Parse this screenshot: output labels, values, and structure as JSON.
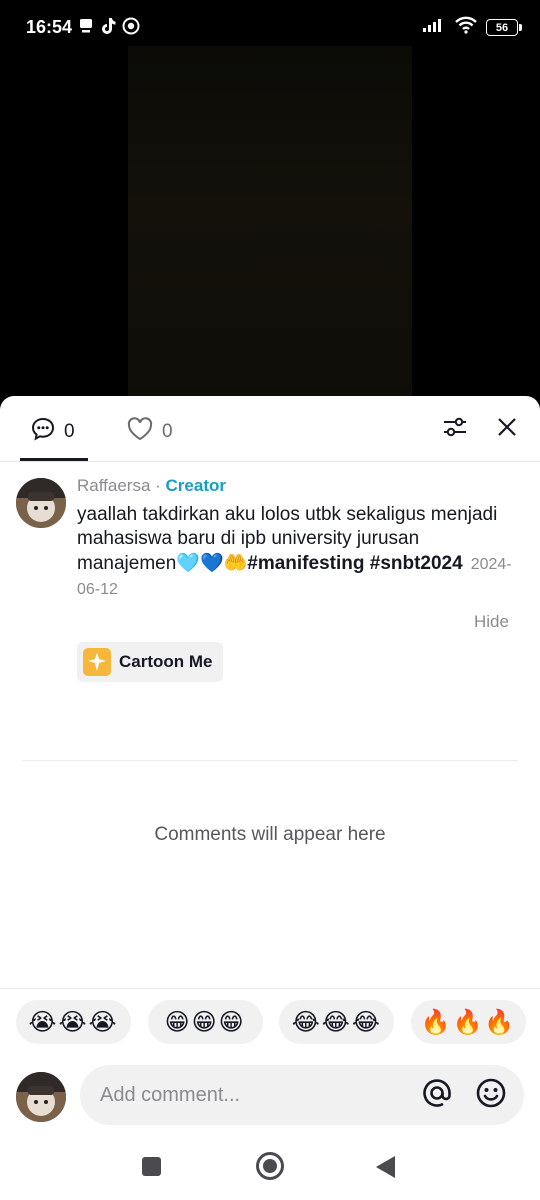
{
  "status_bar": {
    "time": "16:54",
    "battery": "56",
    "left_icons": [
      "notification-icon",
      "tiktok-icon",
      "cast-icon"
    ],
    "right_icons": [
      "signal-icon",
      "wifi-icon",
      "battery-icon"
    ]
  },
  "tabs": {
    "comments_count": "0",
    "likes_count": "0"
  },
  "caption": {
    "username": "Raffaersa",
    "separator": " · ",
    "role": "Creator",
    "text": "yaallah takdirkan aku lolos utbk sekaligus menjadi mahasiswa baru di ipb university jurusan manajemen",
    "emojis": "🩵💙🤲",
    "hashtag1": "#manifesting",
    "hashtag2": "#snbt2024",
    "date": "2024-06-12",
    "hide_label": "Hide",
    "effect_label": "Cartoon Me"
  },
  "empty_state": "Comments will appear here",
  "quick_reactions": [
    {
      "emojis": "😭😭😭"
    },
    {
      "emojis": "😁😁😁"
    },
    {
      "emojis": "😂😂😂"
    },
    {
      "emojis": "🔥🔥🔥"
    }
  ],
  "composer": {
    "placeholder": "Add comment..."
  },
  "colors": {
    "accent_creator": "#1b9cc6",
    "text_primary": "#161823",
    "text_secondary": "#8a8b91"
  }
}
